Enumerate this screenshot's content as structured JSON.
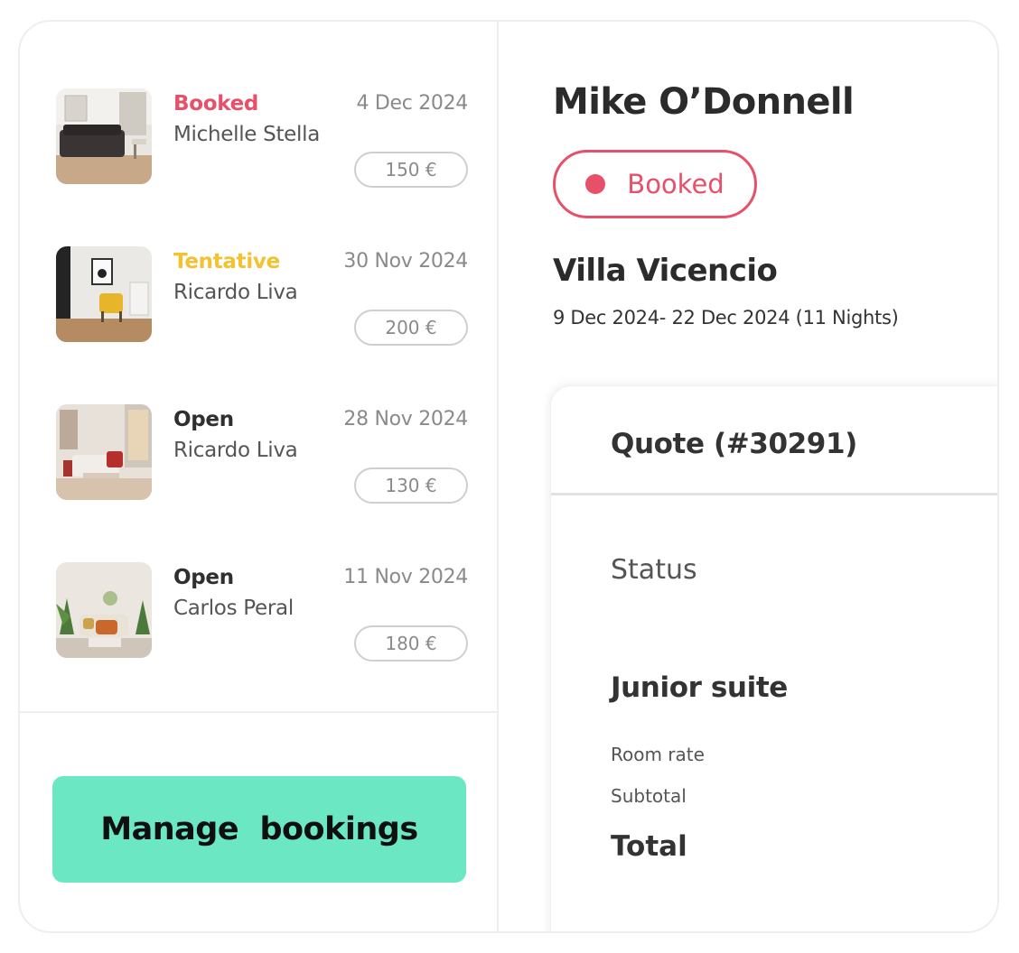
{
  "bookings": [
    {
      "status": "Booked",
      "status_color": "#e8506a",
      "guest": "Michelle Stella",
      "date": "4 Dec 2024",
      "price": "150 €",
      "image": "living-room-photo"
    },
    {
      "status": "Tentative",
      "status_color": "#f2c230",
      "guest": "Ricardo Liva",
      "date": "30 Nov 2024",
      "price": "200 €",
      "image": "living-room-photo"
    },
    {
      "status": "Open",
      "status_color": "#2f2f2f",
      "guest": "Ricardo Liva",
      "date": "28 Nov 2024",
      "price": "130 €",
      "image": "living-room-photo"
    },
    {
      "status": "Open",
      "status_color": "#2f2f2f",
      "guest": "Carlos Peral",
      "date": "11 Nov 2024",
      "price": "180 €",
      "image": "living-room-photo"
    }
  ],
  "manage_button": {
    "label": "Manage  bookings",
    "color": "#6be7c4"
  },
  "detail": {
    "guest_name": "Mike O’Donnell",
    "status": "Booked",
    "status_color": "#e8506a",
    "property": "Villa Vicencio",
    "dates": "9 Dec 2024- 22 Dec 2024 (11 Nights)"
  },
  "quote": {
    "title": "Quote (#30291)",
    "status_label": "Status",
    "room_type": "Junior suite",
    "room_rate_label": "Room rate",
    "subtotal_label": "Subtotal",
    "total_label": "Total"
  }
}
